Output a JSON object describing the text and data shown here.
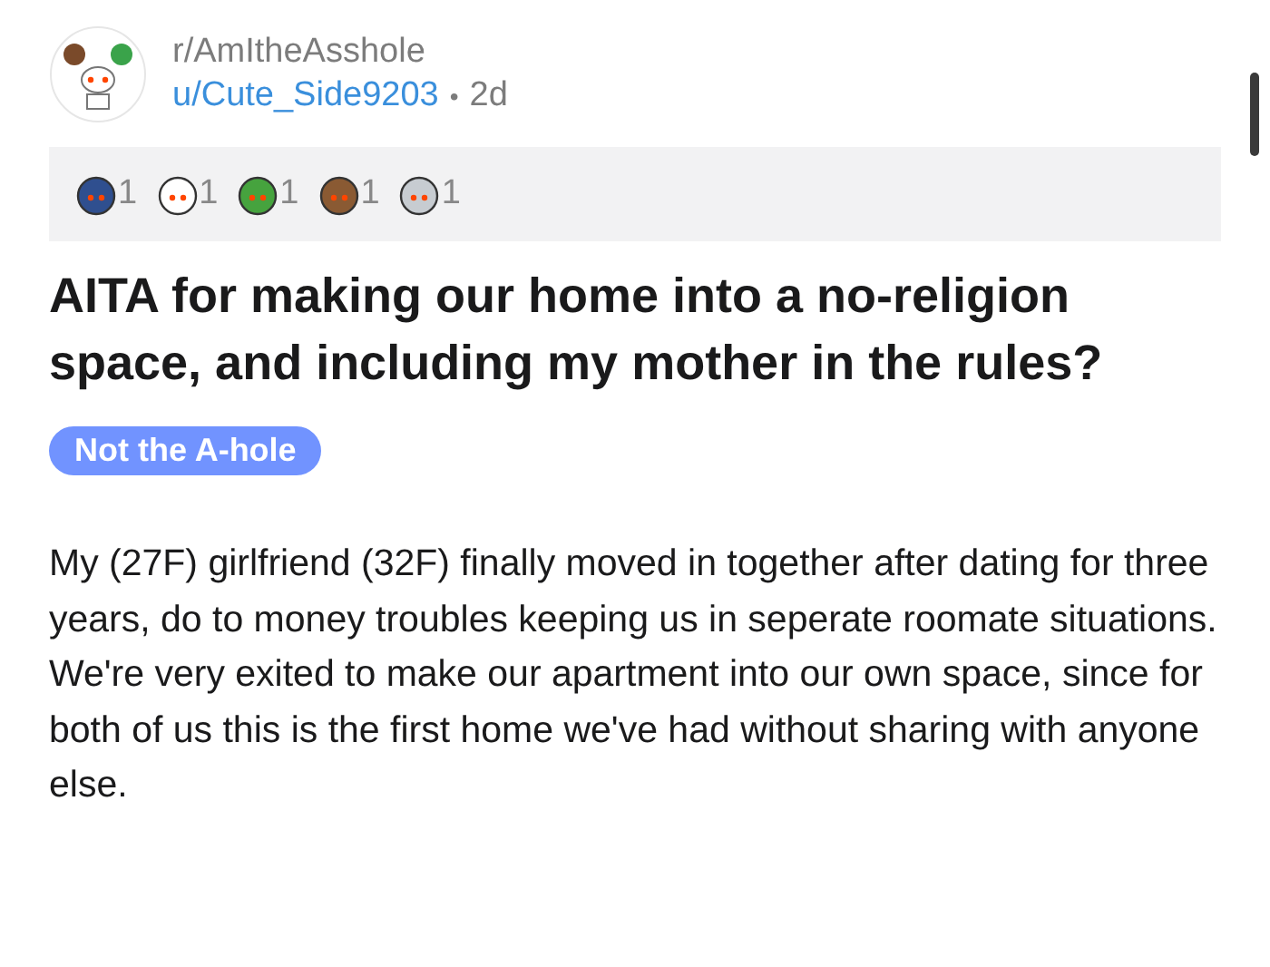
{
  "post": {
    "subreddit": "r/AmItheAsshole",
    "author": "u/Cute_Side9203",
    "separator": "•",
    "age": "2d",
    "awards": [
      {
        "count": "1",
        "color": "#2f4f8f"
      },
      {
        "count": "1",
        "color": "#ffffff"
      },
      {
        "count": "1",
        "color": "#46a33e"
      },
      {
        "count": "1",
        "color": "#8a5a33"
      },
      {
        "count": "1",
        "color": "#c7ccd1"
      }
    ],
    "title": "AITA for making our home into a no-religion space, and including my mother in the rules?",
    "flair": "Not the A-hole",
    "body": "My (27F) girlfriend (32F) finally moved in together after dating for three years, do to money troubles keeping us in seperate roomate situations. We're very exited to make our apartment into our own space, since for both of us this is the first home we've had without sharing with anyone else."
  }
}
